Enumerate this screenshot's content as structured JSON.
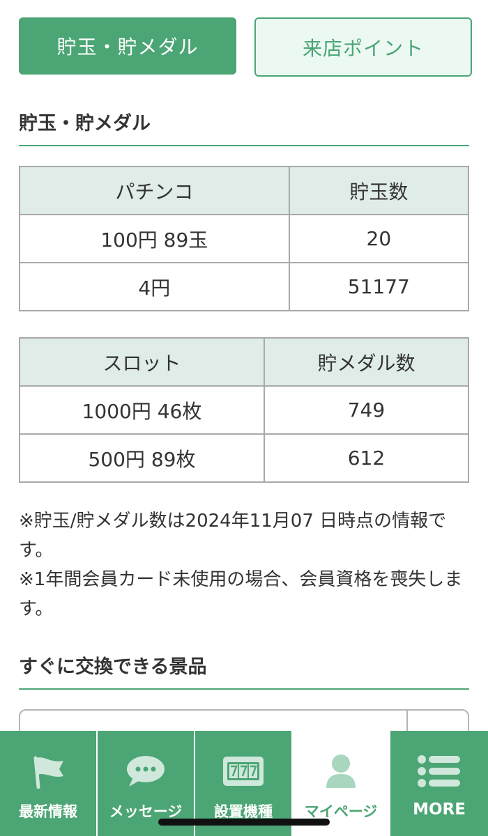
{
  "tabs": {
    "active_label": "貯玉・貯メダル",
    "inactive_label": "来店ポイント"
  },
  "section1": {
    "title": "貯玉・貯メダル"
  },
  "pachinko_table": {
    "headers": [
      "パチンコ",
      "貯玉数"
    ],
    "rows": [
      [
        "100円 89玉",
        "20"
      ],
      [
        "4円",
        "51177"
      ]
    ]
  },
  "slot_table": {
    "headers": [
      "スロット",
      "貯メダル数"
    ],
    "rows": [
      [
        "1000円 46枚",
        "749"
      ],
      [
        "500円 89枚",
        "612"
      ]
    ]
  },
  "notes": {
    "line1": "※貯玉/貯メダル数は2024年11月07 日時点の情報です。",
    "line2": "※1年間会員カード未使用の場合、会員資格を喪失します。"
  },
  "section2": {
    "title": "すぐに交換できる景品"
  },
  "bottom_nav": {
    "items": [
      {
        "label": "最新情報",
        "icon": "flag-icon"
      },
      {
        "label": "メッセージ",
        "icon": "chat-bubble-icon"
      },
      {
        "label": "設置機種",
        "icon": "slot-machine-icon"
      },
      {
        "label": "マイページ",
        "icon": "person-icon"
      },
      {
        "label": "MORE",
        "icon": "menu-list-icon"
      }
    ]
  },
  "colors": {
    "accent": "#4ba574",
    "header_cell": "#dfece7",
    "inactive_tab_bg": "#ecf9f3"
  }
}
